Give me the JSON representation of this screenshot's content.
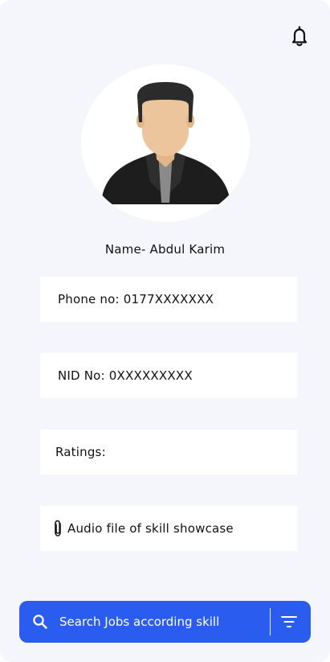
{
  "header": {
    "notification_icon": "bell-icon"
  },
  "profile": {
    "avatar_icon": "user-avatar",
    "name": "Name- Abdul Karim"
  },
  "details": {
    "phone": "Phone no: 0177XXXXXXX",
    "nid": "NID No: 0XXXXXXXXX",
    "ratings": "Ratings:",
    "audio": "Audio file of skill showcase",
    "audio_icon": "paperclip-icon"
  },
  "search": {
    "placeholder": "Search Jobs according skill",
    "value": "",
    "search_icon": "search-icon",
    "filter_icon": "filter-icon"
  },
  "colors": {
    "background": "#f4f6fc",
    "card": "#ffffff",
    "accent": "#2b5cf0",
    "text": "#111111"
  }
}
